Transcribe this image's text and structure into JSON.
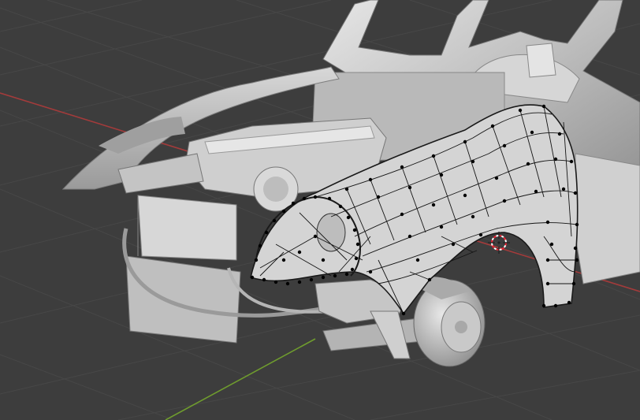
{
  "viewport": {
    "background": "#3d3d3d",
    "grid_color": "#474747",
    "x_axis_color": "#a33b3b",
    "y_axis_color": "#6f9c2e",
    "model_color": "#c8c8c8",
    "mesh_wire_color": "#101010",
    "cursor_icon": "3d-cursor-icon"
  }
}
